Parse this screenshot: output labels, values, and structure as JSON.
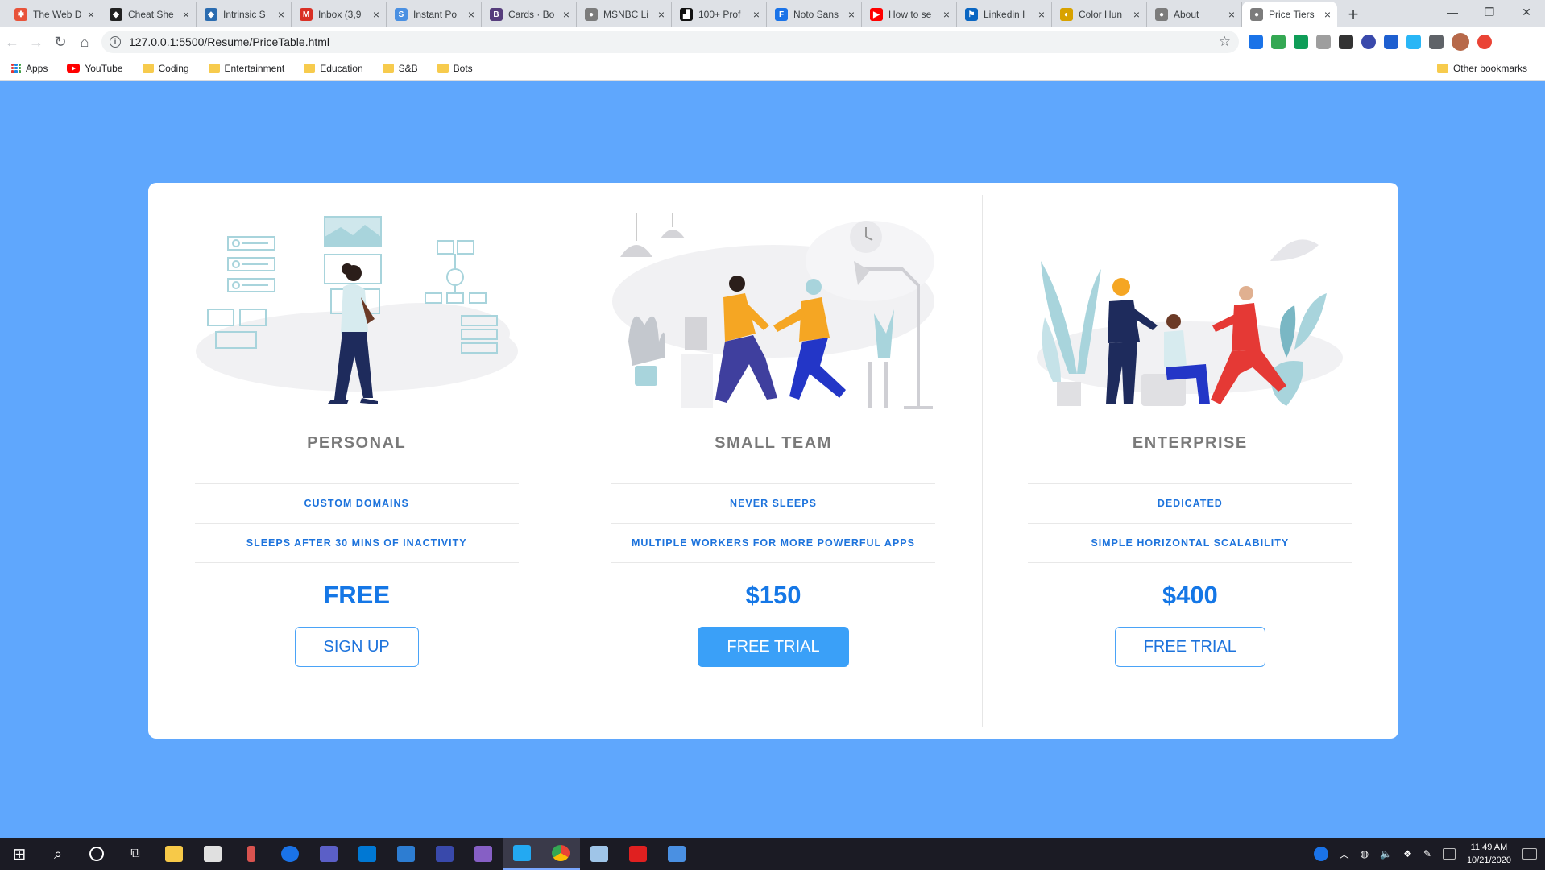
{
  "browser": {
    "tabs": [
      {
        "title": "The Web D",
        "favicon_color": "#e8533a",
        "favicon_text": "✱"
      },
      {
        "title": "Cheat She",
        "favicon_color": "#222222",
        "favicon_text": "◆"
      },
      {
        "title": "Intrinsic S",
        "favicon_color": "#2b6cb0",
        "favicon_text": "◆"
      },
      {
        "title": "Inbox (3,9",
        "favicon_color": "#d93025",
        "favicon_text": "M"
      },
      {
        "title": "Instant Po",
        "favicon_color": "#4a90e2",
        "favicon_text": "S"
      },
      {
        "title": "Cards · Bo",
        "favicon_color": "#563d7c",
        "favicon_text": "B"
      },
      {
        "title": "MSNBC Li",
        "favicon_color": "#7c7c7c",
        "favicon_text": "●"
      },
      {
        "title": "100+ Prof",
        "favicon_color": "#111111",
        "favicon_text": "▟"
      },
      {
        "title": "Noto Sans",
        "favicon_color": "#1a73e8",
        "favicon_text": "F"
      },
      {
        "title": "How to se",
        "favicon_color": "#ff0000",
        "favicon_text": "▶"
      },
      {
        "title": "Linkedin I",
        "favicon_color": "#0a66c2",
        "favicon_text": "⚑"
      },
      {
        "title": "Color Hun",
        "favicon_color": "#d8a200",
        "favicon_text": "◐"
      },
      {
        "title": "About",
        "favicon_color": "#7c7c7c",
        "favicon_text": "●"
      },
      {
        "title": "Price Tiers",
        "favicon_color": "#7c7c7c",
        "favicon_text": "●",
        "active": true
      }
    ],
    "url": "127.0.0.1:5500/Resume/PriceTable.html",
    "bookmarks": [
      "Apps",
      "YouTube",
      "Coding",
      "Entertainment",
      "Education",
      "S&B",
      "Bots"
    ],
    "other_bookmarks": "Other bookmarks"
  },
  "plans": [
    {
      "name": "PERSONAL",
      "features": [
        "CUSTOM DOMAINS",
        "SLEEPS AFTER 30 MINS OF INACTIVITY"
      ],
      "price": "FREE",
      "cta": "SIGN UP",
      "cta_style": "outline"
    },
    {
      "name": "SMALL TEAM",
      "features": [
        "NEVER SLEEPS",
        "MULTIPLE WORKERS FOR MORE POWERFUL APPS"
      ],
      "price": "$150",
      "cta": "FREE TRIAL",
      "cta_style": "filled"
    },
    {
      "name": "ENTERPRISE",
      "features": [
        "DEDICATED",
        "SIMPLE HORIZONTAL SCALABILITY"
      ],
      "price": "$400",
      "cta": "FREE TRIAL",
      "cta_style": "outline"
    }
  ],
  "colors": {
    "page_background": "#5fa7fd",
    "accent": "#1d73dc",
    "button_fill": "#3aa0f8"
  },
  "taskbar": {
    "time": "11:49 AM",
    "date": "10/21/2020"
  }
}
